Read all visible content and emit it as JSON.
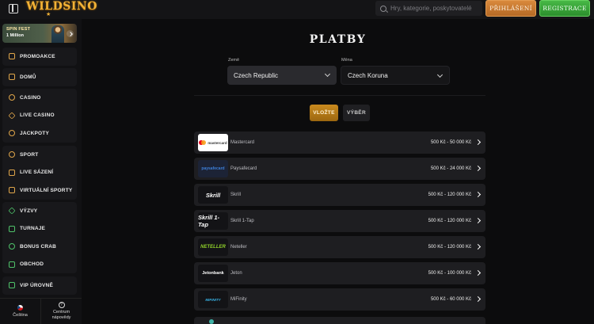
{
  "header": {
    "logo_text": "WILDSINO",
    "logo_star": "★",
    "search_placeholder": "Hry, kategorie, poskytovatelé",
    "login_label": "PŘIHLÁŠENÍ",
    "register_label": "REGISTRACE"
  },
  "sidebar": {
    "promo": {
      "title": "SPIN FEST",
      "subtitle": "1 Million"
    },
    "groups": [
      [
        {
          "label": "PROMOAKCE",
          "icon": "gift-icon"
        }
      ],
      [
        {
          "label": "DOMŮ",
          "icon": "home-icon"
        }
      ],
      [
        {
          "label": "CASINO",
          "icon": "casino-chip-icon"
        },
        {
          "label": "LIVE CASINO",
          "icon": "spade-icon"
        },
        {
          "label": "JACKPOTY",
          "icon": "jackpot-icon"
        }
      ],
      [
        {
          "label": "SPORT",
          "icon": "ball-icon"
        },
        {
          "label": "LIVE SÁZENÍ",
          "icon": "live-screen-icon"
        },
        {
          "label": "VIRTUÁLNÍ SPORTY",
          "icon": "virtual-screen-icon"
        }
      ],
      [
        {
          "label": "VÝZVY",
          "icon": "challenge-icon"
        },
        {
          "label": "TURNAJE",
          "icon": "trophy-icon"
        },
        {
          "label": "BONUS CRAB",
          "icon": "crab-icon"
        },
        {
          "label": "OBCHOD",
          "icon": "shop-icon"
        }
      ],
      [
        {
          "label": "VIP ÚROVNĚ",
          "icon": "vip-crown-icon"
        }
      ]
    ],
    "language_label": "Čeština",
    "help_label_1": "Centrum",
    "help_label_2": "nápovědy"
  },
  "main": {
    "title": "PLATBY",
    "country_label": "Země",
    "country_value": "Czech Republic",
    "currency_label": "Měna",
    "currency_value": "Czech Koruna",
    "tab_deposit": "VLOŽTE",
    "tab_withdraw": "VÝBĚR",
    "methods": [
      {
        "name": "Mastercard",
        "range": "500 Kč - 50 000 Kč",
        "logo": "mastercard"
      },
      {
        "name": "Paysafecard",
        "range": "500 Kč - 24 000 Kč",
        "logo": "paysafecard"
      },
      {
        "name": "Skrill",
        "range": "500 Kč - 120 000 Kč",
        "logo": "Skrill"
      },
      {
        "name": "Skrill 1-Tap",
        "range": "500 Kč - 120 000 Kč",
        "logo": "Skrill 1-Tap"
      },
      {
        "name": "Neteller",
        "range": "500 Kč - 120 000 Kč",
        "logo": "NETELLER"
      },
      {
        "name": "Jeton",
        "range": "500 Kč - 100 000 Kč",
        "logo": "Jetonbank"
      },
      {
        "name": "MiFinity",
        "range": "500 Kč - 60 000 Kč",
        "logo": "MIFINITY"
      }
    ]
  }
}
